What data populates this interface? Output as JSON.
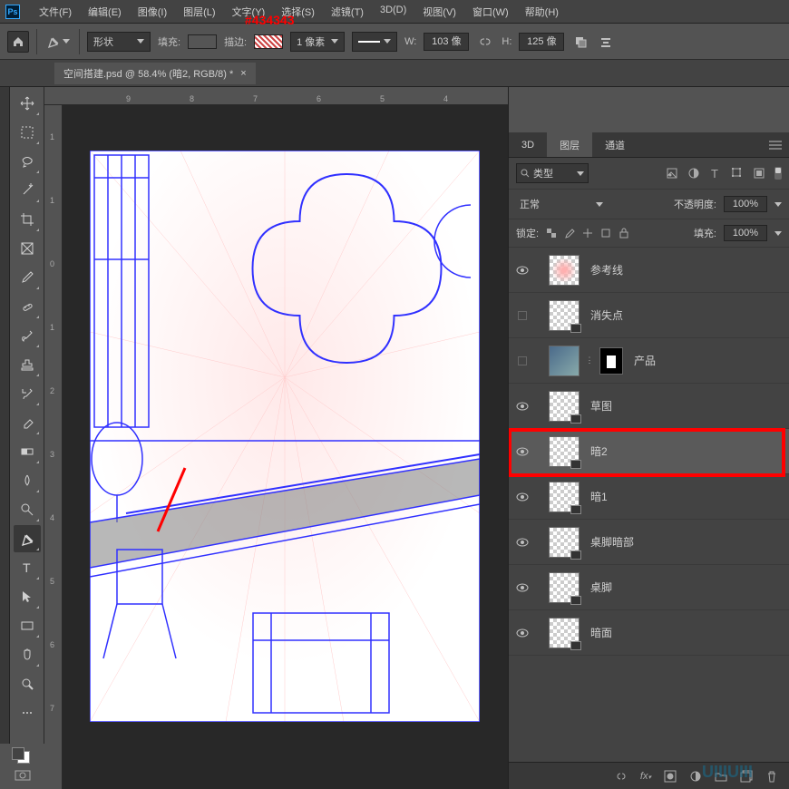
{
  "annotation": "#434343",
  "menu": [
    "文件(F)",
    "编辑(E)",
    "图像(I)",
    "图层(L)",
    "文字(Y)",
    "选择(S)",
    "滤镜(T)",
    "3D(D)",
    "视图(V)",
    "窗口(W)",
    "帮助(H)"
  ],
  "options": {
    "shape_mode": "形状",
    "fill_label": "填充:",
    "stroke_label": "描边:",
    "stroke_value": "1 像素",
    "w_label": "W:",
    "w_value": "103 像",
    "h_label": "H:",
    "h_value": "125 像"
  },
  "document_tab": "空间搭建.psd @ 58.4% (暗2, RGB/8) *",
  "rulers_h": [
    {
      "pos": 70,
      "label": "9"
    },
    {
      "pos": 140,
      "label": "8"
    },
    {
      "pos": 210,
      "label": "7"
    },
    {
      "pos": 280,
      "label": "6"
    },
    {
      "pos": 350,
      "label": "5"
    },
    {
      "pos": 420,
      "label": "4"
    }
  ],
  "rulers_v": [
    {
      "pos": 30,
      "label": "1"
    },
    {
      "pos": 100,
      "label": "1"
    },
    {
      "pos": 170,
      "label": "0"
    },
    {
      "pos": 240,
      "label": "1"
    },
    {
      "pos": 310,
      "label": "2"
    },
    {
      "pos": 380,
      "label": "3"
    },
    {
      "pos": 450,
      "label": "4"
    },
    {
      "pos": 520,
      "label": "5"
    },
    {
      "pos": 590,
      "label": "6"
    },
    {
      "pos": 660,
      "label": "7"
    }
  ],
  "panel_tabs": {
    "t3d": "3D",
    "layers": "图层",
    "channels": "通道"
  },
  "layers_panel": {
    "search_label": "类型",
    "blend_mode": "正常",
    "opacity_label": "不透明度:",
    "opacity_value": "100%",
    "lock_label": "锁定:",
    "fill_label": "填充:",
    "fill_value": "100%"
  },
  "layers": [
    {
      "name": "参考线",
      "visible": true,
      "checker": true
    },
    {
      "name": "消失点",
      "visible": false,
      "checker": true,
      "badge": true
    },
    {
      "name": "产品",
      "visible": false,
      "mask": true,
      "img": true
    },
    {
      "name": "草图",
      "visible": true,
      "checker": true,
      "badge": true
    },
    {
      "name": "暗2",
      "visible": true,
      "checker": true,
      "badge": true,
      "selected": true
    },
    {
      "name": "暗1",
      "visible": true,
      "checker": true,
      "badge": true
    },
    {
      "name": "桌脚暗部",
      "visible": true,
      "checker": true,
      "badge": true
    },
    {
      "name": "桌脚",
      "visible": true,
      "checker": true,
      "badge": true
    },
    {
      "name": "暗面",
      "visible": true,
      "checker": true,
      "badge": true
    }
  ],
  "watermark": "UIIIUIII"
}
